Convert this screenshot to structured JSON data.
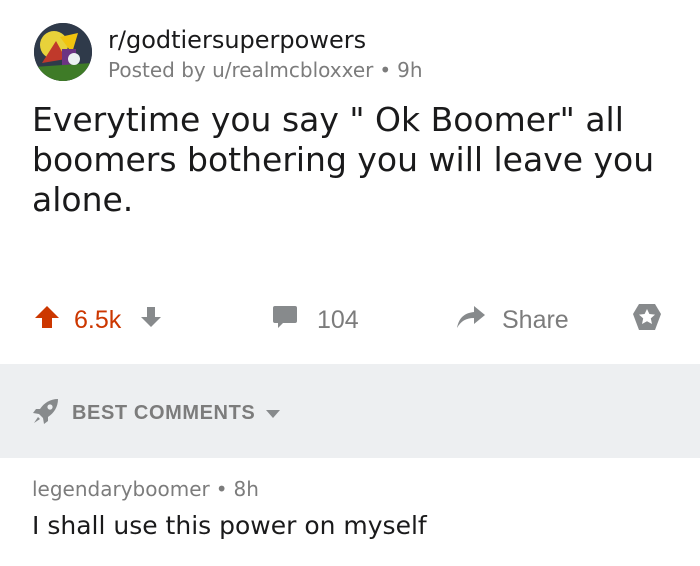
{
  "post": {
    "subreddit": "r/godtiersuperpowers",
    "posted_by": "Posted by u/realmcbloxxer",
    "separator": "•",
    "age": "9h",
    "title": "Everytime you say \" Ok Boomer\" all boomers bothering you will leave you alone.",
    "avatar_icon": "subreddit-avatar"
  },
  "actions": {
    "score": "6.5k",
    "comments": "104",
    "share_label": "Share",
    "upvote_icon": "upvote-arrow-icon",
    "downvote_icon": "downvote-arrow-icon",
    "comment_icon": "comment-bubble-icon",
    "share_icon": "share-arrow-icon",
    "award_icon": "award-star-icon"
  },
  "comments_header": {
    "sort_label": "BEST COMMENTS",
    "sort_icon": "rocket-icon",
    "chevron_icon": "chevron-down-icon"
  },
  "comment": {
    "author": "legendaryboomer",
    "separator": "•",
    "age": "8h",
    "body": "I shall use this power on myself"
  },
  "colors": {
    "upvoted": "#cc3700",
    "muted": "#878a8c",
    "strip_bg": "#edeff1",
    "text": "#1a1a1b"
  }
}
